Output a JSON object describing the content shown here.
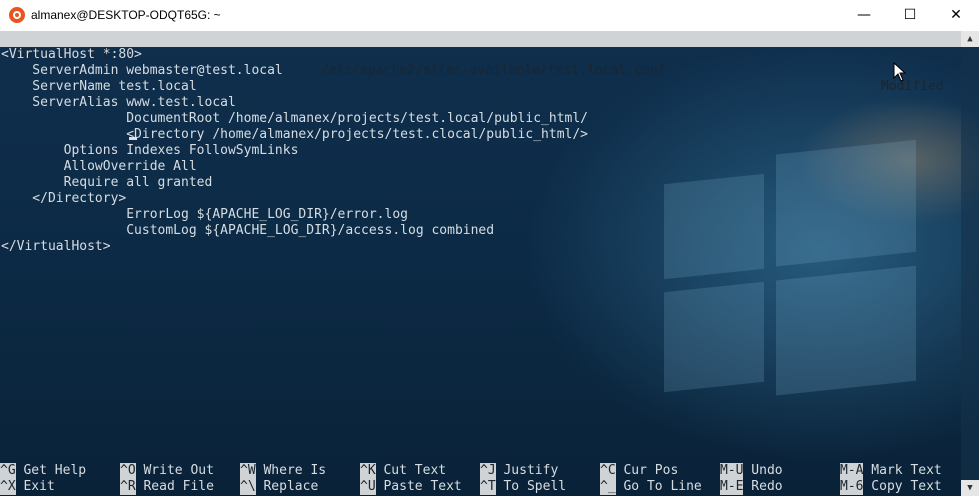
{
  "window": {
    "title": "almanex@DESKTOP-ODQT65G: ~",
    "minimize": "—",
    "maximize": "☐",
    "close": "✕"
  },
  "nano": {
    "version": "GNU nano 4.8",
    "file": "/etc/apache2/sites-available/test.local.conf",
    "status": "Modified"
  },
  "lines": [
    "<VirtualHost *:80>",
    "    ServerAdmin webmaster@test.local",
    "    ServerName test.local",
    "    ServerAlias www.test.local",
    "                DocumentRoot /home/almanex/projects/test.local/public_html/",
    "                <Directory /home/almanex/projects/test.clocal/public_html/>",
    "        Options Indexes FollowSymLinks",
    "        AllowOverride All",
    "        Require all granted",
    "    </Directory>",
    "                ErrorLog ${APACHE_LOG_DIR}/error.log",
    "                CustomLog ${APACHE_LOG_DIR}/access.log combined",
    "</VirtualHost>"
  ],
  "shortcuts": [
    {
      "key": "^G",
      "label": " Get Help"
    },
    {
      "key": "^O",
      "label": " Write Out"
    },
    {
      "key": "^W",
      "label": " Where Is"
    },
    {
      "key": "^K",
      "label": " Cut Text"
    },
    {
      "key": "^J",
      "label": " Justify"
    },
    {
      "key": "^C",
      "label": " Cur Pos"
    },
    {
      "key": "M-U",
      "label": " Undo"
    },
    {
      "key": "M-A",
      "label": " Mark Text"
    },
    {
      "key": "^X",
      "label": " Exit"
    },
    {
      "key": "^R",
      "label": " Read File"
    },
    {
      "key": "^\\",
      "label": " Replace"
    },
    {
      "key": "^U",
      "label": " Paste Text"
    },
    {
      "key": "^T",
      "label": " To Spell"
    },
    {
      "key": "^_",
      "label": " Go To Line"
    },
    {
      "key": "M-E",
      "label": " Redo"
    },
    {
      "key": "M-6",
      "label": " Copy Text"
    }
  ]
}
